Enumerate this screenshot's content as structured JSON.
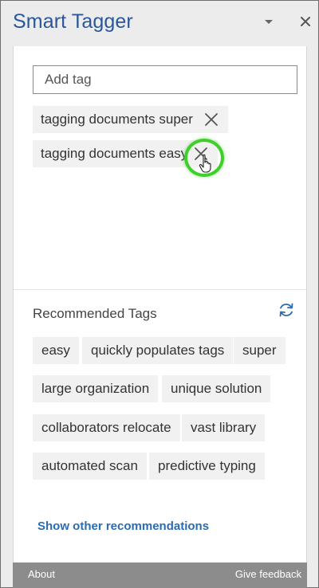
{
  "pane": {
    "title": "Smart Tagger"
  },
  "tag_input": {
    "placeholder": "Add tag",
    "value": ""
  },
  "applied_tags": [
    {
      "label": "tagging documents super"
    },
    {
      "label": "tagging documents easy"
    }
  ],
  "recommended": {
    "heading": "Recommended Tags",
    "tags": [
      {
        "label": "easy"
      },
      {
        "label": "quickly populates tags"
      },
      {
        "label": "super"
      },
      {
        "label": "large organization"
      },
      {
        "label": "unique solution"
      },
      {
        "label": "collaborators relocate"
      },
      {
        "label": "vast library"
      },
      {
        "label": "automated scan"
      },
      {
        "label": "predictive typing"
      }
    ],
    "show_more_label": "Show other recommendations"
  },
  "footer": {
    "about_label": "About",
    "feedback_label": "Give feedback"
  },
  "colors": {
    "title": "#2b579a",
    "link": "#2b6cb0",
    "highlight_ring": "#3fcf2a",
    "footer_bg": "#8c8c8c"
  },
  "icons": {
    "dropdown": "chevron-down-icon",
    "close_pane": "close-icon",
    "remove_tag": "close-icon",
    "refresh": "refresh-icon",
    "cursor": "hand-pointer-icon"
  }
}
